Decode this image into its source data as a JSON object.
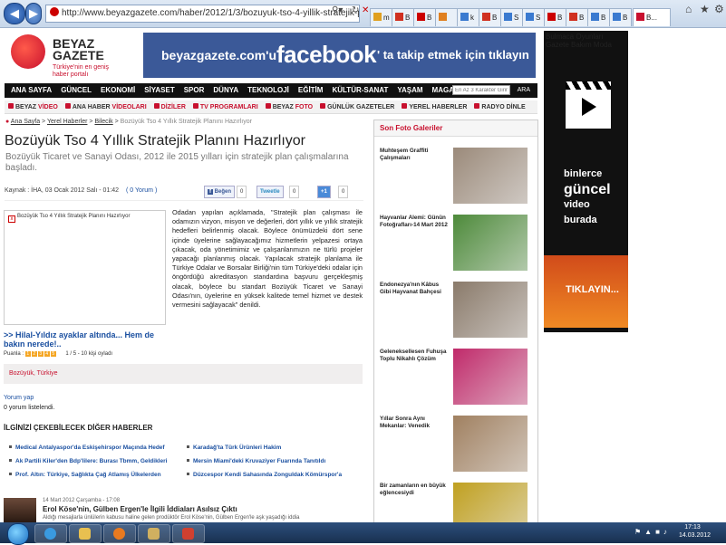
{
  "browser": {
    "url": "http://www.beyazgazete.com/haber/2012/1/3/bozuyuk-tso-4-yillik-stratejik-planini-hazi",
    "tabs": [
      {
        "label": "m"
      },
      {
        "label": "B"
      },
      {
        "label": "B"
      },
      {
        "label": ""
      },
      {
        "label": "k"
      },
      {
        "label": "B"
      },
      {
        "label": "S"
      },
      {
        "label": "S"
      },
      {
        "label": "B"
      },
      {
        "label": "B"
      },
      {
        "label": "B"
      },
      {
        "label": "B"
      }
    ],
    "active_tab_label": "B...",
    "colors": {
      "chrome": "#c7d7ea"
    }
  },
  "site": {
    "logo_line1": "BEYAZ",
    "logo_line2": "GAZETE",
    "logo_tagline": "Türkiye'nin en geniş haber portalı",
    "brand_color": "#c8102e",
    "facebook_banner": {
      "left": "beyazgazete.com'u",
      "brand": "facebook",
      "right": "' ta takip etmek için tıklayın",
      "color": "#3b5998"
    },
    "nav_main": [
      "ANA SAYFA",
      "GÜNCEL",
      "EKONOMİ",
      "SİYASET",
      "SPOR",
      "DÜNYA",
      "TEKNOLOJİ",
      "EĞİTİM",
      "KÜLTÜR-SANAT",
      "YAŞAM",
      "MAGAZİN",
      "3. SAYFA"
    ],
    "search_placeholder": "En Az 3 Karakter Giriniz",
    "search_button": "ARA",
    "nav_secondary": [
      {
        "a": "BEYAZ",
        "b": "VİDEO"
      },
      {
        "a": "ANA HABER",
        "b": "VİDEOLARI"
      },
      {
        "a": "",
        "b": "DİZİLER"
      },
      {
        "a": "",
        "b": "TV PROGRAMLARI"
      },
      {
        "a": "BEYAZ",
        "b": "FOTO"
      },
      {
        "a": "GÜNLÜK GAZETELER",
        "b": ""
      },
      {
        "a": "YEREL HABERLER",
        "b": ""
      },
      {
        "a": "RADYO DİNLE",
        "b": ""
      }
    ]
  },
  "article": {
    "breadcrumb": [
      "Ana Sayfa",
      "Yerel Haberler",
      "Bilecik"
    ],
    "breadcrumb_current": "Bozüyük Tso 4 Yıllık Stratejik Planını Hazırlıyor",
    "title": "Bozüyük Tso 4 Yıllık Stratejik Planını Hazırlıyor",
    "subtitle": "Bozüyük Ticaret ve Sanayi Odası, 2012 ile 2015 yılları için stratejik plan çalışmalarına başladı.",
    "meta": "Kaynak : İHA, 03 Ocak 2012 Salı - 01:42",
    "comment_count": "( 0 Yorum )",
    "share": {
      "facebook": "Beğen",
      "facebook_count": "0",
      "twitter": "Tweetle",
      "twitter_count": "0",
      "gplus": "+1",
      "gplus_count": "0"
    },
    "image_caption": "Bozüyük Tso 4 Yıllık Stratejik Planını Hazırlıyor",
    "body": "Odadan yapılan açıklamada, \"Stratejik plan çalışması ile odamızın vizyon, misyon ve değerleri, dört yıllık ve yıllık stratejik hedefleri belirlenmiş olacak. Böylece önümüzdeki dört sene içinde üyelerine sağlayacağımız hizmetlerin yelpazesi ortaya çıkacak, oda yönetimimiz ve çalışanlarımızın ne türlü projeler yapacağı planlanmış olacak. Yapılacak stratejik planlama ile Türkiye Odalar ve Borsalar Birliği'nin tüm Türkiye'deki odalar için öngördüğü akreditasyon standardına başvuru gerçekleşmiş olacak, böylece bu standart Bozüyük Ticaret ve Sanayi Odası'nın, üyelerine en yüksek kalitede temel hizmet ve destek vermesini sağlayacak\" denildi.",
    "related_link": ">> Hilal-Yıldız ayaklar altında... Hem de bakın nerede!..",
    "rating_label": "Puanla :",
    "rating_stars": [
      "1",
      "2",
      "3",
      "4",
      "5"
    ],
    "rating_result": "1 / 5 - 10 kişi oyladı",
    "tags": "Bozüyük, Türkiye",
    "comment_link": "Yorum yap",
    "comment_list": "0 yorum listelendi.",
    "other_heading": "İLGİNİZİ ÇEKEBİLECEK DİĞER HABERLER",
    "other_news": [
      "Medical Antalyaspor'da Eskişehirspor Maçında Hedef",
      "Karadağ'ta Türk Ürünleri Hakim",
      "Ak Partili Kiler'den Bdp'lilere: Burası Tbmm, Geldikleri",
      "Mersin Miami'deki Kruvaziyer Fuarında Tanıtıldı",
      "Prof. Altın: Türkiye, Sağlıkta Çağ Atlamış Ülkelerden",
      "Düzcespor Kendi Sahasında Zonguldak Kömürspor'a"
    ],
    "featured": {
      "date": "14 Mart 2012 Çarşamba - 17:08",
      "headline": "Erol Köse'nin, Gülben Ergen'le İlgili İddiaları Asılsız Çıktı",
      "snippet": "Aldığı mesajlarla ünlülerin kabusu haline gelen prodüktör Erol Köse'nin, Gülben Ergen'le aşk yaşadığı iddia"
    }
  },
  "sidebar": {
    "heading": "Son Foto Galeriler",
    "galleries": [
      {
        "title": "Muhteşem Graffiti Çalışmaları",
        "color": "#9b8a7a"
      },
      {
        "title": "Hayvanlar Alemi: Günün Fotoğrafları-14 Mart 2012",
        "color": "#4d8a3a"
      },
      {
        "title": "Endonezya'nın Kâbus Gibi Hayvanat Bahçesi",
        "color": "#8a7a6a"
      },
      {
        "title": "Geleneksellesen Fuhuşa Toplu Nikahlı Çözüm",
        "color": "#c02a6a"
      },
      {
        "title": "Yıllar Sonra Aynı Mekanlar: Venedik",
        "color": "#a08060"
      },
      {
        "title": "Bir zamanların en büyük eğlencesiydi",
        "color": "#c0a020"
      }
    ]
  },
  "ad": {
    "line1": "binlerce",
    "line2": "güncel",
    "line3": "video",
    "line4": "burada",
    "cta": "TIKLAYIN...",
    "faint_text": "Bulmaca Oyunları Gazete Bakım Moda"
  },
  "taskbar": {
    "time": "17:13",
    "date": "14.03.2012"
  }
}
